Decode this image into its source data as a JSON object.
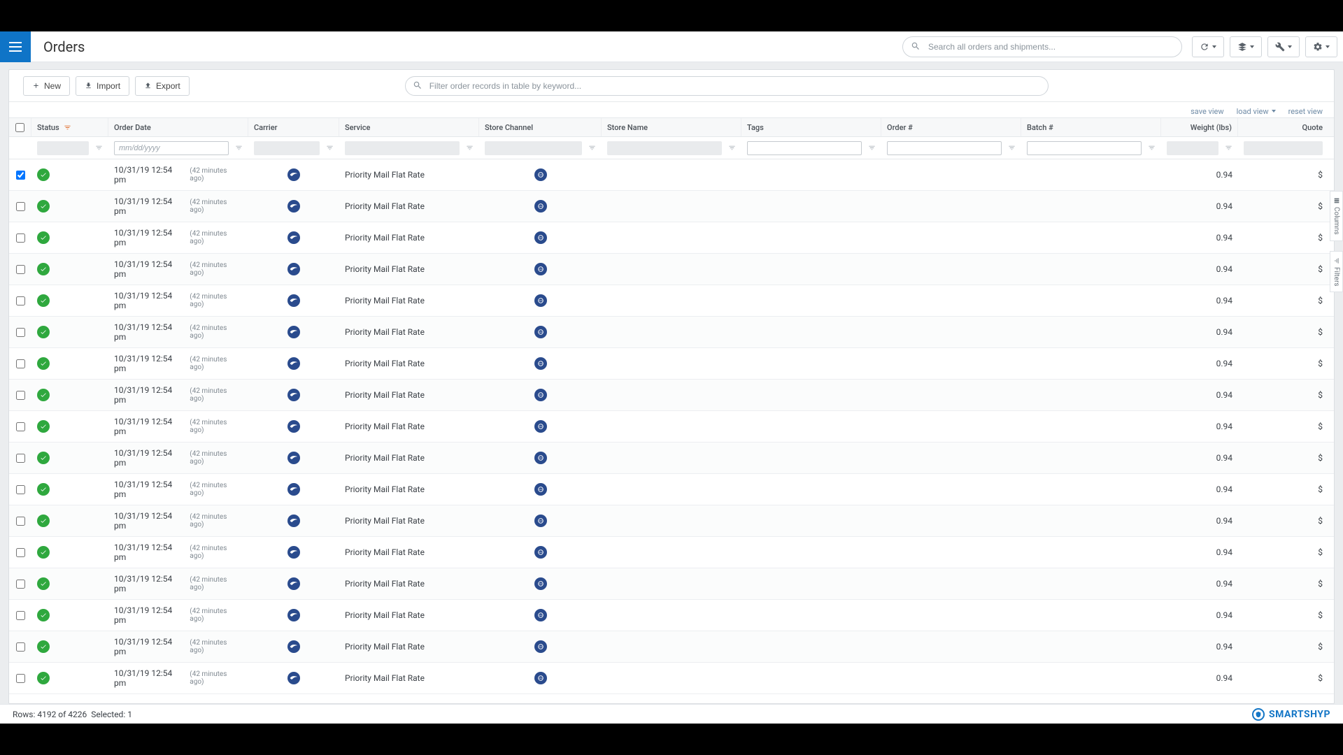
{
  "header": {
    "title": "Orders",
    "search_placeholder": "Search all orders and shipments..."
  },
  "panel_toolbar": {
    "new_label": "New",
    "import_label": "Import",
    "export_label": "Export",
    "filter_placeholder": "Filter order records in table by keyword..."
  },
  "view_links": {
    "save": "save view",
    "load": "load view",
    "reset": "reset view"
  },
  "columns": {
    "status": "Status",
    "order_date": "Order Date",
    "carrier": "Carrier",
    "service": "Service",
    "store_channel": "Store Channel",
    "store_name": "Store Name",
    "tags": "Tags",
    "order_num": "Order #",
    "batch_num": "Batch #",
    "weight": "Weight (lbs)",
    "quote": "Quote"
  },
  "filters": {
    "date_placeholder": "mm/dd/yyyy"
  },
  "row_template": {
    "date": "10/31/19 12:54 pm",
    "date_rel": "(42 minutes ago)",
    "service": "Priority Mail Flat Rate",
    "weight": "0.94",
    "quote": "$"
  },
  "side_tabs": {
    "columns": "Columns",
    "filters": "Filters"
  },
  "footer": {
    "rows_label": "Rows:",
    "rows_value": "4192 of 4226",
    "selected_label": "Selected:",
    "selected_value": "1",
    "brand": "SMARTSHYP"
  },
  "row_count": 17
}
